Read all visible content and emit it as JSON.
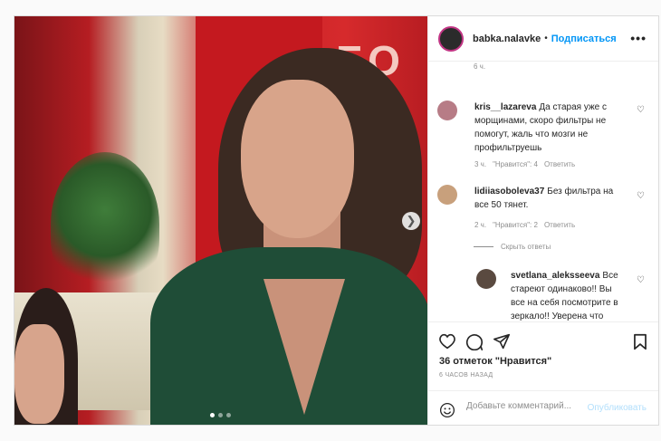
{
  "post": {
    "photo_sign_text": "БО",
    "author": {
      "username": "babka.nalavke",
      "separator": "•",
      "follow_label": "Подписаться",
      "more_label": "•••"
    },
    "comments_top_time": "6 ч.",
    "comments": [
      {
        "username": "kris__lazareva",
        "text": "Да старая уже с морщинами, скоро фильтры не помогут, жаль что мозги не профильтруешь",
        "time": "3 ч.",
        "likes": "\"Нравится\": 4",
        "reply_label": "Ответить"
      },
      {
        "username": "lidiiasoboleva37",
        "text": "Без фильтра на все 50 тянет.",
        "time": "2 ч.",
        "likes": "\"Нравится\": 2",
        "reply_label": "Ответить"
      }
    ],
    "hide_replies_label": "Скрыть ответы",
    "reply": {
      "username": "svetlana_aleksseeva",
      "text": "Все стареют одинаково!! Вы все на себя посмотрите в зеркало!! Уверена что смотритесь хуже буковой!! Только себя"
    },
    "likes_count": "36 отметок \"Нравится\"",
    "time_ago": "6 ЧАСОВ НАЗАД",
    "add_comment_placeholder": "Добавьте комментарий...",
    "publish_label": "Опубликовать",
    "carousel": {
      "total": 3,
      "active": 1
    },
    "colors": {
      "accent": "#0095f6",
      "publish_disabled": "#b2dffc",
      "muted": "#8e8e8e",
      "jacket": "#1f4d37",
      "backdrop": "#c4191f"
    },
    "icons": {
      "like": "heart-icon",
      "comment": "comment-icon",
      "share": "paper-plane-icon",
      "save": "bookmark-icon",
      "emoji": "emoji-icon",
      "next": "chevron-right-icon"
    }
  }
}
